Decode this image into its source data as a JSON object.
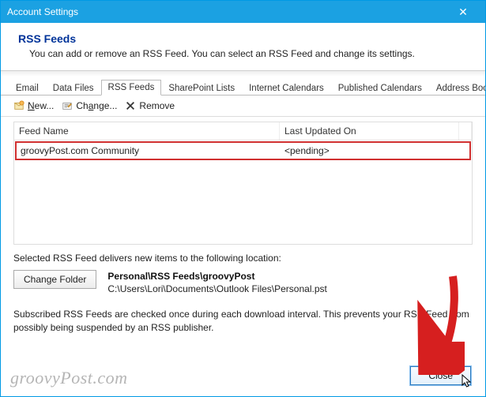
{
  "window": {
    "title": "Account Settings",
    "close_glyph": "✕"
  },
  "header": {
    "title": "RSS Feeds",
    "subtitle": "You can add or remove an RSS Feed. You can select an RSS Feed and change its settings."
  },
  "tabs": [
    {
      "label": "Email"
    },
    {
      "label": "Data Files"
    },
    {
      "label": "RSS Feeds",
      "active": true
    },
    {
      "label": "SharePoint Lists"
    },
    {
      "label": "Internet Calendars"
    },
    {
      "label": "Published Calendars"
    },
    {
      "label": "Address Books"
    }
  ],
  "toolbar": {
    "new_label": "New...",
    "change_label": "Change...",
    "remove_label": "Remove"
  },
  "table": {
    "col_feed": "Feed Name",
    "col_updated": "Last Updated On",
    "rows": [
      {
        "name": "groovyPost.com Community",
        "updated": "<pending>"
      }
    ]
  },
  "lower": {
    "delivers_text": "Selected RSS Feed delivers new items to the following location:",
    "change_folder_label": "Change Folder",
    "folder_path": "Personal\\RSS Feeds\\groovyPost",
    "file_path": "C:\\Users\\Lori\\Documents\\Outlook Files\\Personal.pst",
    "footnote": "Subscribed RSS Feeds are checked once during each download interval. This prevents your RSS Feed from possibly being suspended by an RSS publisher."
  },
  "footer": {
    "close_label": "Close"
  },
  "watermark": "groovyPost.com"
}
